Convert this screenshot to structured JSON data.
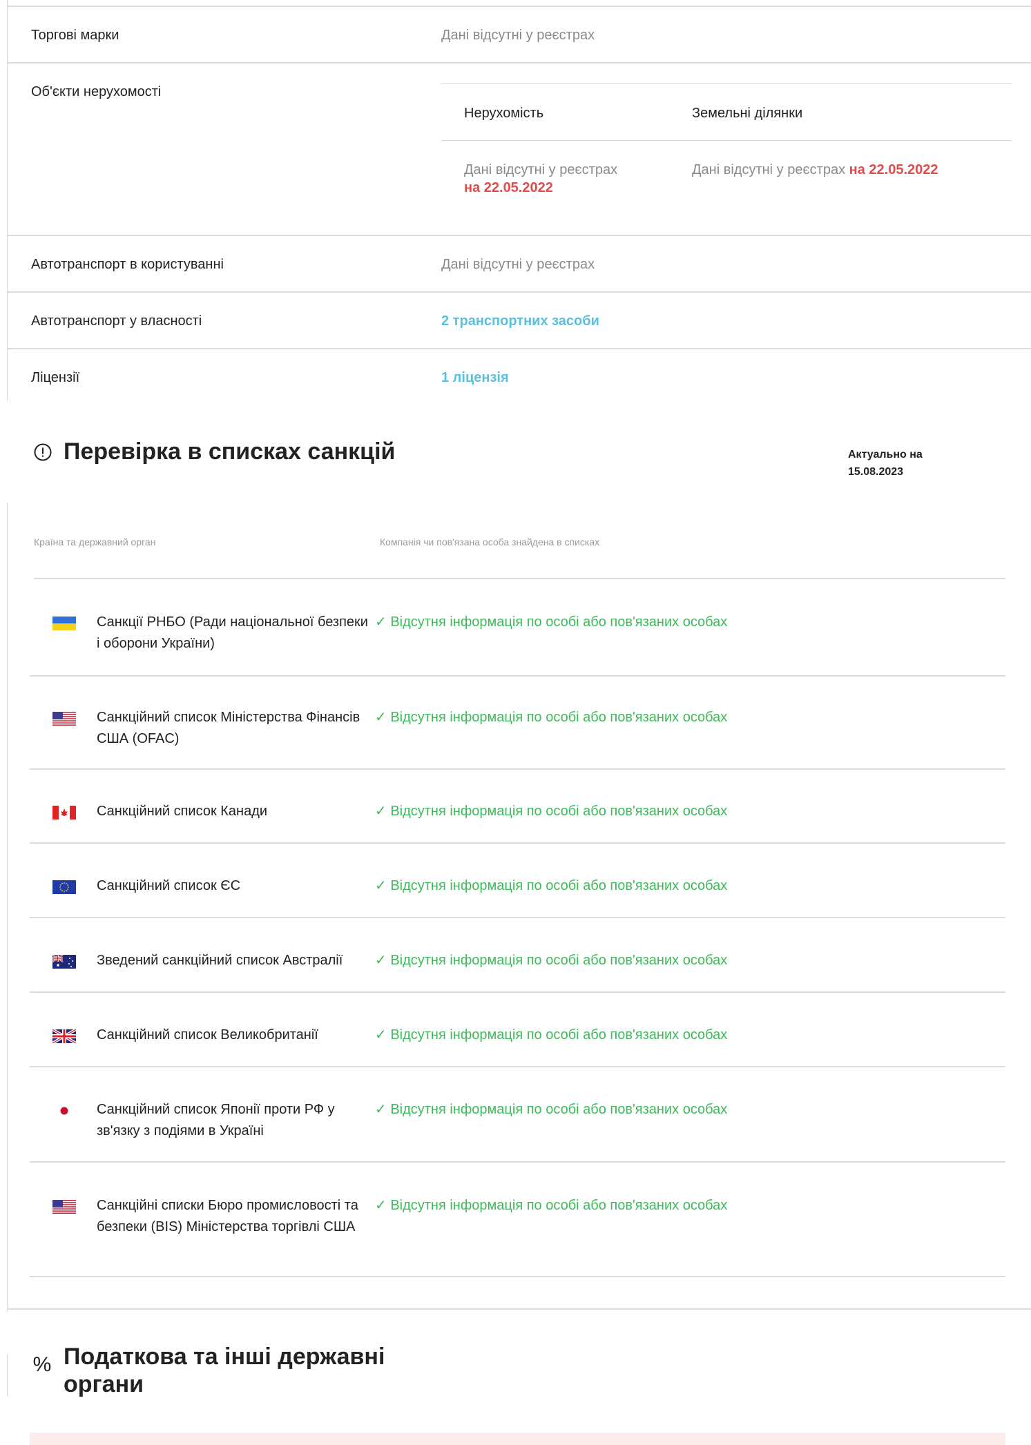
{
  "registry": {
    "trademarks": {
      "label": "Торгові марки",
      "value": "Дані відсутні у реєстрах"
    },
    "real_estate": {
      "label": "Об'єкти нерухомості",
      "col1_head": "Нерухомість",
      "col2_head": "Земельні ділянки",
      "col1_text": "Дані відсутні у реєстрах",
      "col2_text": "Дані відсутні у реєстрах",
      "date": "на 22.05.2022"
    },
    "vehicles_use": {
      "label": "Автотранспорт в користуванні",
      "value": "Дані відсутні у реєстрах"
    },
    "vehicles_own": {
      "label": "Автотранспорт у власності",
      "value": "2 транспортних засоби"
    },
    "licenses": {
      "label": "Ліцензії",
      "value": "1 ліцензія"
    }
  },
  "sanctions": {
    "title": "Перевірка в списках санкцій",
    "actual_label": "Актуально на",
    "actual_date": "15.08.2023",
    "col_country": "Країна та державний орган",
    "col_found": "Компанія чи пов'язана особа знайдена в списках",
    "status_text": "✓ Відсутня інформація по особі або пов'язаних особах",
    "rows": [
      {
        "flag": "ukraine-flag-icon",
        "name": "Санкції РНБО (Ради національної безпеки і оборони України)"
      },
      {
        "flag": "usa-flag-icon",
        "name": "Санкційний список Міністерства Фінансів США (OFAC)"
      },
      {
        "flag": "canada-flag-icon",
        "name": "Санкційний список Канади"
      },
      {
        "flag": "eu-flag-icon",
        "name": "Санкційний список ЄС"
      },
      {
        "flag": "australia-flag-icon",
        "name": "Зведений санкційний список Австралії"
      },
      {
        "flag": "uk-flag-icon",
        "name": "Санкційний список Великобританії"
      },
      {
        "flag": "japan-flag-icon",
        "name": "Санкційний список Японії проти РФ у зв'язку з подіями в Україні"
      },
      {
        "flag": "usa-flag-icon",
        "name": "Санкційні списки Бюро промисловості та безпеки (BIS) Міністерства торгівлі США"
      }
    ]
  },
  "tax": {
    "title": "Податкова та інші державні органи"
  },
  "colors": {
    "link": "#5bc0de",
    "date_red": "#e04b4b",
    "ok_green": "#3dbb5a"
  }
}
